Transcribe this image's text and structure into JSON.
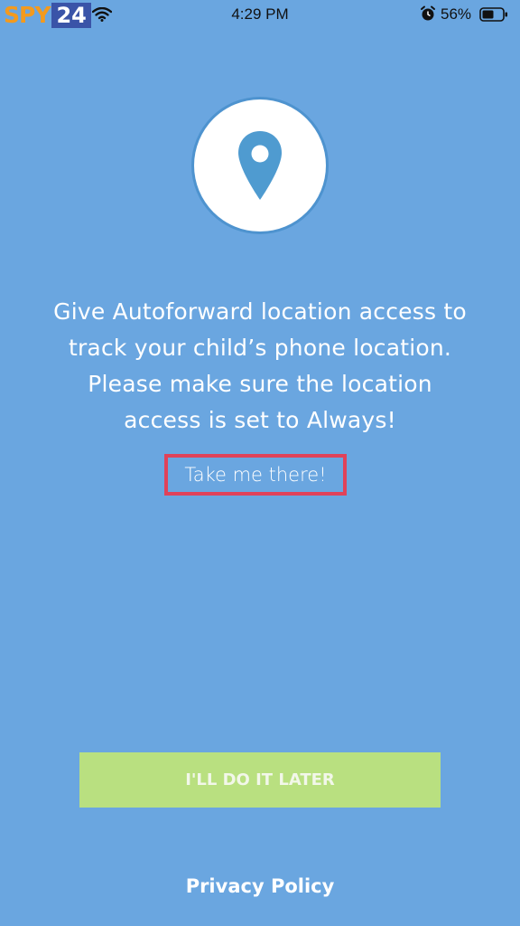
{
  "status_bar": {
    "logo_text_a": "SPY",
    "logo_text_b": "24",
    "time": "4:29 PM",
    "battery_percent": "56%",
    "icons": [
      "wifi-icon",
      "alarm-icon",
      "battery-icon"
    ]
  },
  "main": {
    "icon": "location-pin-icon",
    "message_lines": [
      "Give Autoforward location access to",
      "track your child’s phone location.",
      "Please make sure the location",
      "access is set to Always!"
    ],
    "take_me_there": "Take me there!",
    "later_button": "I'LL DO IT LATER",
    "privacy_policy": "Privacy Policy"
  },
  "colors": {
    "background": "#6aa6e0",
    "pin": "#4f9bd0",
    "button": "#b9e080",
    "highlight_border": "#e0425a"
  }
}
